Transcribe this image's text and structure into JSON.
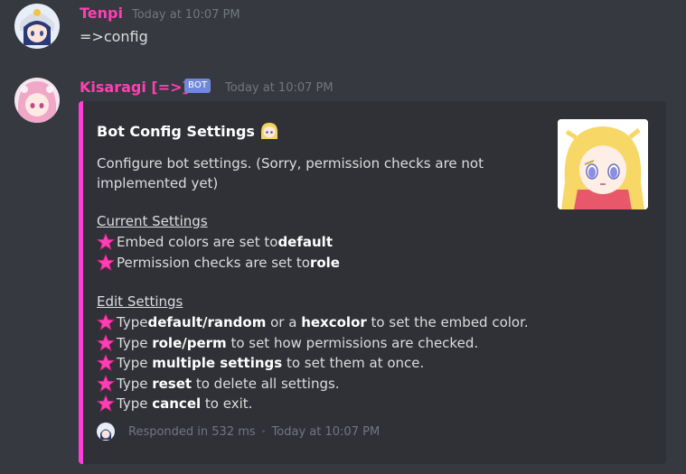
{
  "message1": {
    "username": "Tenpi",
    "timestamp": "Today at 10:07 PM",
    "text": "=>config"
  },
  "message2": {
    "username": "Kisaragi [=>]",
    "badge": "BOT",
    "timestamp": "Today at 10:07 PM"
  },
  "embed": {
    "accent_color": "#ff3fd8",
    "title": "Bot Config Settings",
    "description": "Configure bot settings. (Sorry, permission checks are not implemented yet)",
    "current_heading": "Current Settings",
    "current": [
      {
        "pre": "Embed colors are set to ",
        "bold": "default",
        "post": ""
      },
      {
        "pre": "Permission checks are set to ",
        "bold": "role",
        "post": ""
      }
    ],
    "edit_heading": "Edit Settings",
    "edit": [
      {
        "pre": "Type ",
        "bold": "default/random",
        "mid": " or a ",
        "bold2": "hexcolor",
        "post": " to set the embed color."
      },
      {
        "pre": "Type ",
        "bold": "role/perm",
        "post": " to set how permissions are checked."
      },
      {
        "pre": "Type ",
        "bold": "multiple settings",
        "post": " to set them at once."
      },
      {
        "pre": "Type ",
        "bold": "reset",
        "post": " to delete all settings."
      },
      {
        "pre": "Type ",
        "bold": "cancel",
        "post": " to exit."
      }
    ],
    "footer": {
      "responded": "Responded in 532 ms",
      "separator": "•",
      "timestamp": "Today at 10:07 PM"
    }
  },
  "colors": {
    "background": "#36393f",
    "embed_bg": "#2f3136",
    "username": "#ff3fb4",
    "badge": "#7289da",
    "star": "#ff3fb4"
  }
}
